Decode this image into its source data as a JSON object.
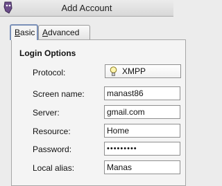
{
  "window": {
    "title": "Add Account"
  },
  "tabs": [
    {
      "label_ul": "B",
      "label_rest": "asic"
    },
    {
      "label_ul": "A",
      "label_rest": "dvanced"
    }
  ],
  "section": {
    "title": "Login Options"
  },
  "fields": {
    "protocol": {
      "label": "Protocol:",
      "value": "XMPP",
      "icon": "lightbulb-icon"
    },
    "screen_name": {
      "label": "Screen name:",
      "value": "manast86"
    },
    "server": {
      "label": "Server:",
      "value": "gmail.com"
    },
    "resource": {
      "label": "Resource:",
      "value": "Home"
    },
    "password": {
      "label": "Password:",
      "value": "•••••••••"
    },
    "local_alias": {
      "label": "Local alias:",
      "value": "Manas"
    }
  },
  "colors": {
    "window_bg": "#ececec",
    "panel_bg": "#f4f4f4",
    "active_tab_border": "#7a90b8"
  }
}
